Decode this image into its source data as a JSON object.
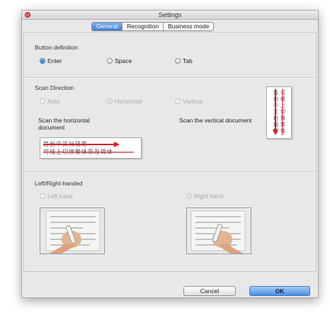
{
  "window": {
    "title": "Settings"
  },
  "tabs": [
    {
      "label": "General",
      "active": true
    },
    {
      "label": "Recognition",
      "active": false
    },
    {
      "label": "Business mode",
      "active": false
    }
  ],
  "button_definition": {
    "title": "Button definition",
    "options": [
      {
        "label": "Enter",
        "selected": true
      },
      {
        "label": "Space",
        "selected": false
      },
      {
        "label": "Tab",
        "selected": false
      }
    ]
  },
  "scan_direction": {
    "title": "Scan Direction",
    "options": [
      {
        "label": "Auto",
        "selected": false,
        "enabled": false
      },
      {
        "label": "Horizontal",
        "selected": true,
        "enabled": false
      },
      {
        "label": "Vertical",
        "selected": false,
        "enabled": false
      }
    ],
    "horizontal_desc": "Scan the horizontal document",
    "vertical_desc": "Scan the vertical document",
    "sample_horizontal": {
      "line1": "首创中文扫描笔",
      "line2": "可线上切换繁体版及简体"
    },
    "sample_vertical": {
      "line1": "首创中文扫描笔",
      "line2": "可线上切换繁体"
    }
  },
  "handedness": {
    "title": "Left/Right-handed",
    "options": [
      {
        "label": "Left hand",
        "selected": false,
        "enabled": false
      },
      {
        "label": "Right hand",
        "selected": true,
        "enabled": false
      }
    ]
  },
  "footer": {
    "cancel_label": "Cancel",
    "ok_label": "OK"
  },
  "colors": {
    "accent": "#4a8ee3",
    "arrow": "#d42020"
  }
}
